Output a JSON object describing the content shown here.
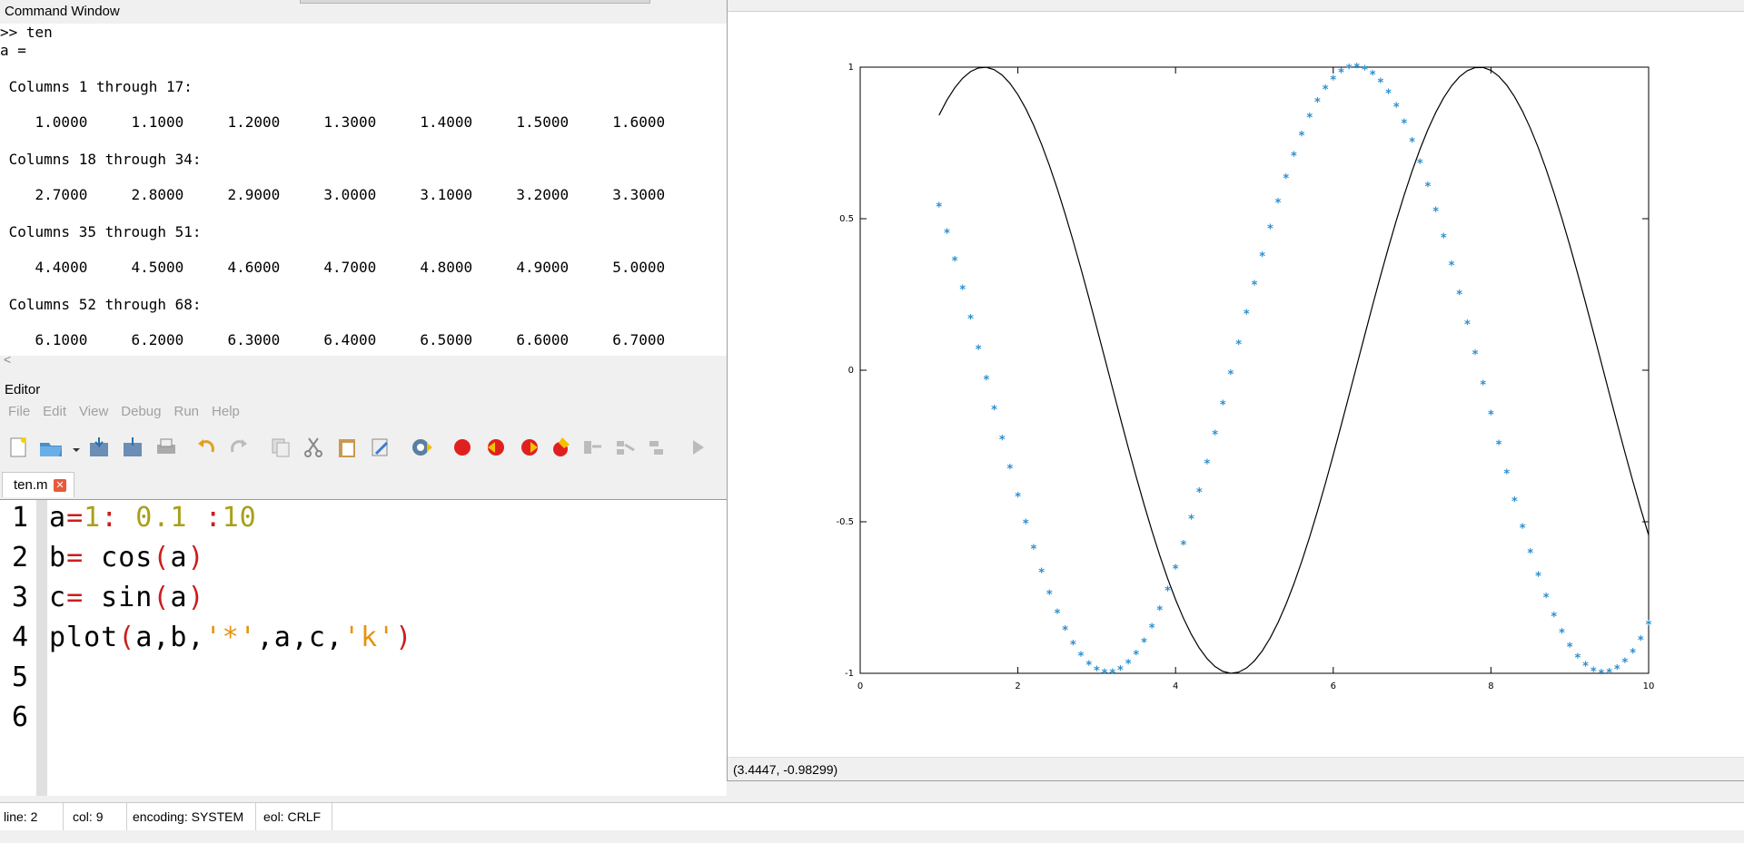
{
  "command_window": {
    "title": "Command Window",
    "prompt": ">> ten",
    "assign": "a =",
    "blocks": [
      {
        "header": " Columns 1 through 17:",
        "values": "    1.0000     1.1000     1.2000     1.3000     1.4000     1.5000     1.6000"
      },
      {
        "header": " Columns 18 through 34:",
        "values": "    2.7000     2.8000     2.9000     3.0000     3.1000     3.2000     3.3000"
      },
      {
        "header": " Columns 35 through 51:",
        "values": "    4.4000     4.5000     4.6000     4.7000     4.8000     4.9000     5.0000"
      },
      {
        "header": " Columns 52 through 68:",
        "values": "    6.1000     6.2000     6.3000     6.4000     6.5000     6.6000     6.7000"
      }
    ]
  },
  "editor": {
    "title": "Editor",
    "menu": [
      "File",
      "Edit",
      "View",
      "Debug",
      "Run",
      "Help"
    ],
    "tab": "ten.m",
    "line_numbers": [
      "1",
      "2",
      "3",
      "4",
      "5",
      "6"
    ],
    "colors": {
      "keyword_red": "#cc1d1d",
      "number_olive": "#a8a019",
      "string_orange": "#e8920e",
      "plain": "#000000"
    }
  },
  "status_bar": {
    "line_label": "line:",
    "line_value": "2",
    "col_label": "col:",
    "col_value": "9",
    "encoding_label": "encoding:",
    "encoding_value": "SYSTEM",
    "eol_label": "eol:",
    "eol_value": "CRLF"
  },
  "figure": {
    "coords_readout": "(3.4447, -0.98299)"
  },
  "chart_data": {
    "type": "line",
    "title": "",
    "xlabel": "",
    "ylabel": "",
    "xlim": [
      0,
      10
    ],
    "ylim": [
      -1,
      1
    ],
    "xticks": [
      "0",
      "2",
      "4",
      "6",
      "8",
      "10"
    ],
    "yticks": [
      "-1",
      "-0.5",
      "0",
      "0.5",
      "1"
    ],
    "x_range": {
      "start": 1,
      "step": 0.1,
      "end": 10
    },
    "series": [
      {
        "function": "cos",
        "style": "markers",
        "marker": "*",
        "color": "#2a8fd0"
      },
      {
        "function": "sin",
        "style": "line",
        "color": "#000000"
      }
    ],
    "grid": false
  }
}
